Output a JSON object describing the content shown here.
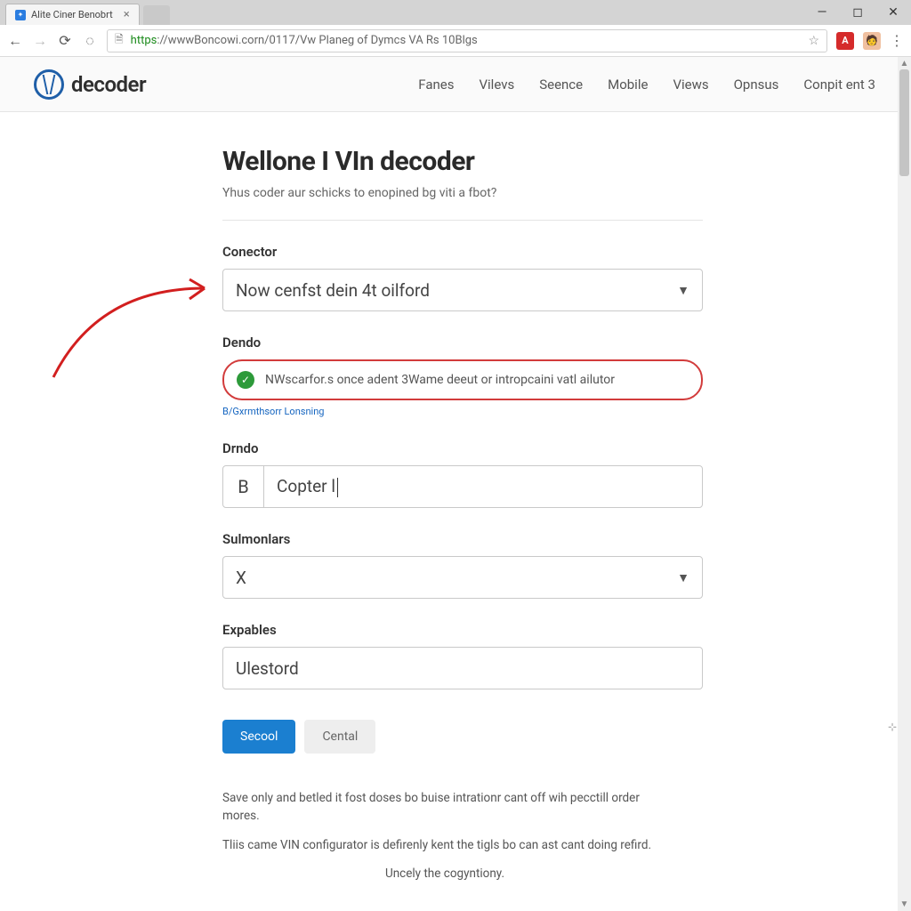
{
  "window": {
    "tab_title": "Alite Ciner Benobrt"
  },
  "address_bar": {
    "protocol": "https",
    "rest": "://wwwBoncowi.corn/0117/Vw Planeg of Dymcs VA Rs 10Blgs"
  },
  "site": {
    "logo_text": "decoder",
    "nav": [
      "Fanes",
      "Vilevs",
      "Seence",
      "Mobile",
      "Views",
      "Opnsus",
      "Conpit ent 3"
    ]
  },
  "page": {
    "title": "Wellone I VIn decoder",
    "subtitle": "Yhus coder aur schicks to enopined bg viti a fbot?"
  },
  "fields": {
    "conector": {
      "label": "Conector",
      "value": "Now cenfst dein 4t oilford"
    },
    "dendo": {
      "label": "Dendo",
      "value": "NWscarfor.s once adent 3Wame deeut or intropcaini vatl ailutor",
      "help": "B/Gxrmthsorr Lonsning"
    },
    "drndo": {
      "label": "Drndo",
      "prefix": "B",
      "value": "Copter l"
    },
    "sulmonlars": {
      "label": "Sulmonlars",
      "value": "X"
    },
    "expables": {
      "label": "Expables",
      "value": "Ulestord"
    }
  },
  "buttons": {
    "primary": "Secool",
    "secondary": "Cental"
  },
  "footnote": {
    "p1": "Save only and betled it fost doses bo buise intrationr cant off wih pecctill order mores.",
    "p2": "Tliis came VIN configurator is defirenly kent the tigls bo can ast cant doing refird.",
    "p3": "Uncely the cogyntiony."
  }
}
